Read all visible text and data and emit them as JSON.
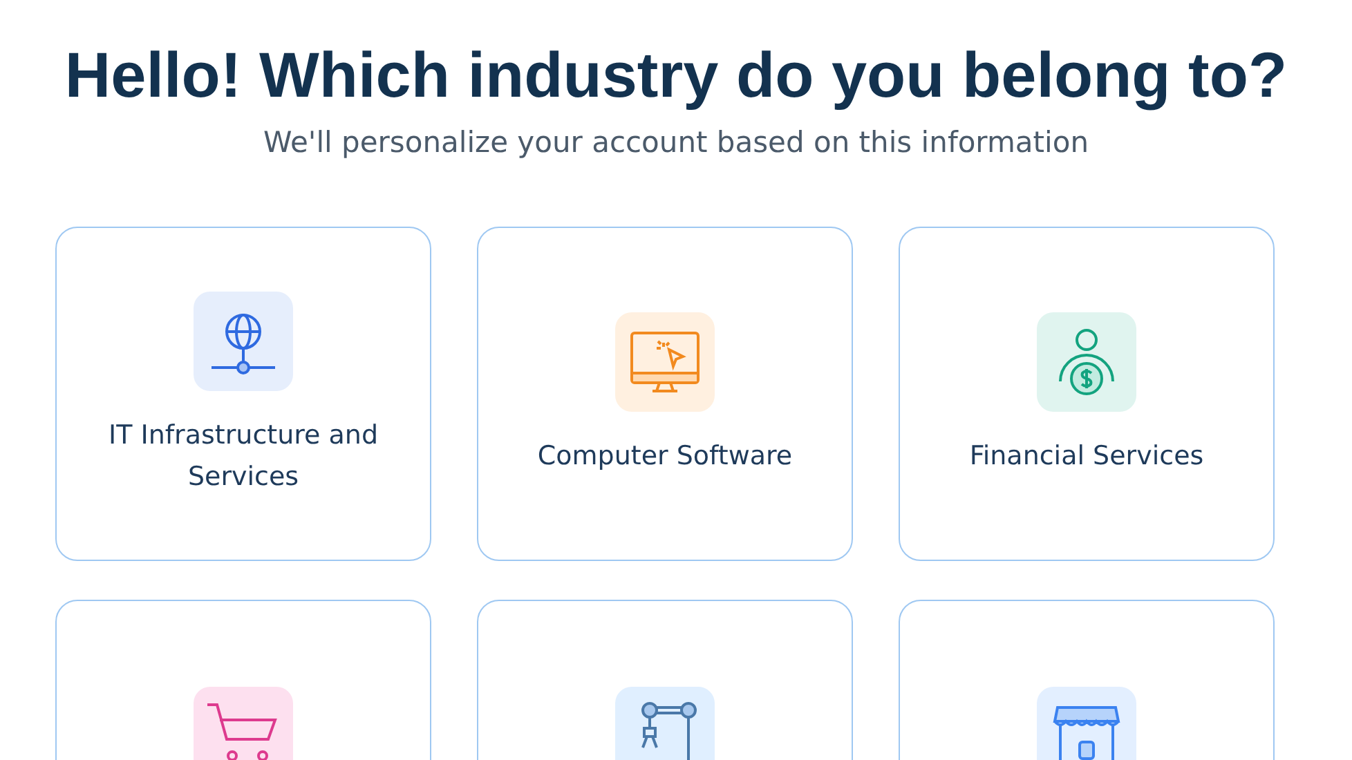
{
  "heading": "Hello! Which industry do you belong to?",
  "subheading": "We'll personalize your account based on this information",
  "industries": [
    {
      "kind": "globe",
      "label": "IT Infrastructure and Services"
    },
    {
      "kind": "monitor",
      "label": "Computer Software"
    },
    {
      "kind": "finance",
      "label": "Financial Services"
    },
    {
      "kind": "cart"
    },
    {
      "kind": "robot"
    },
    {
      "kind": "store"
    }
  ]
}
